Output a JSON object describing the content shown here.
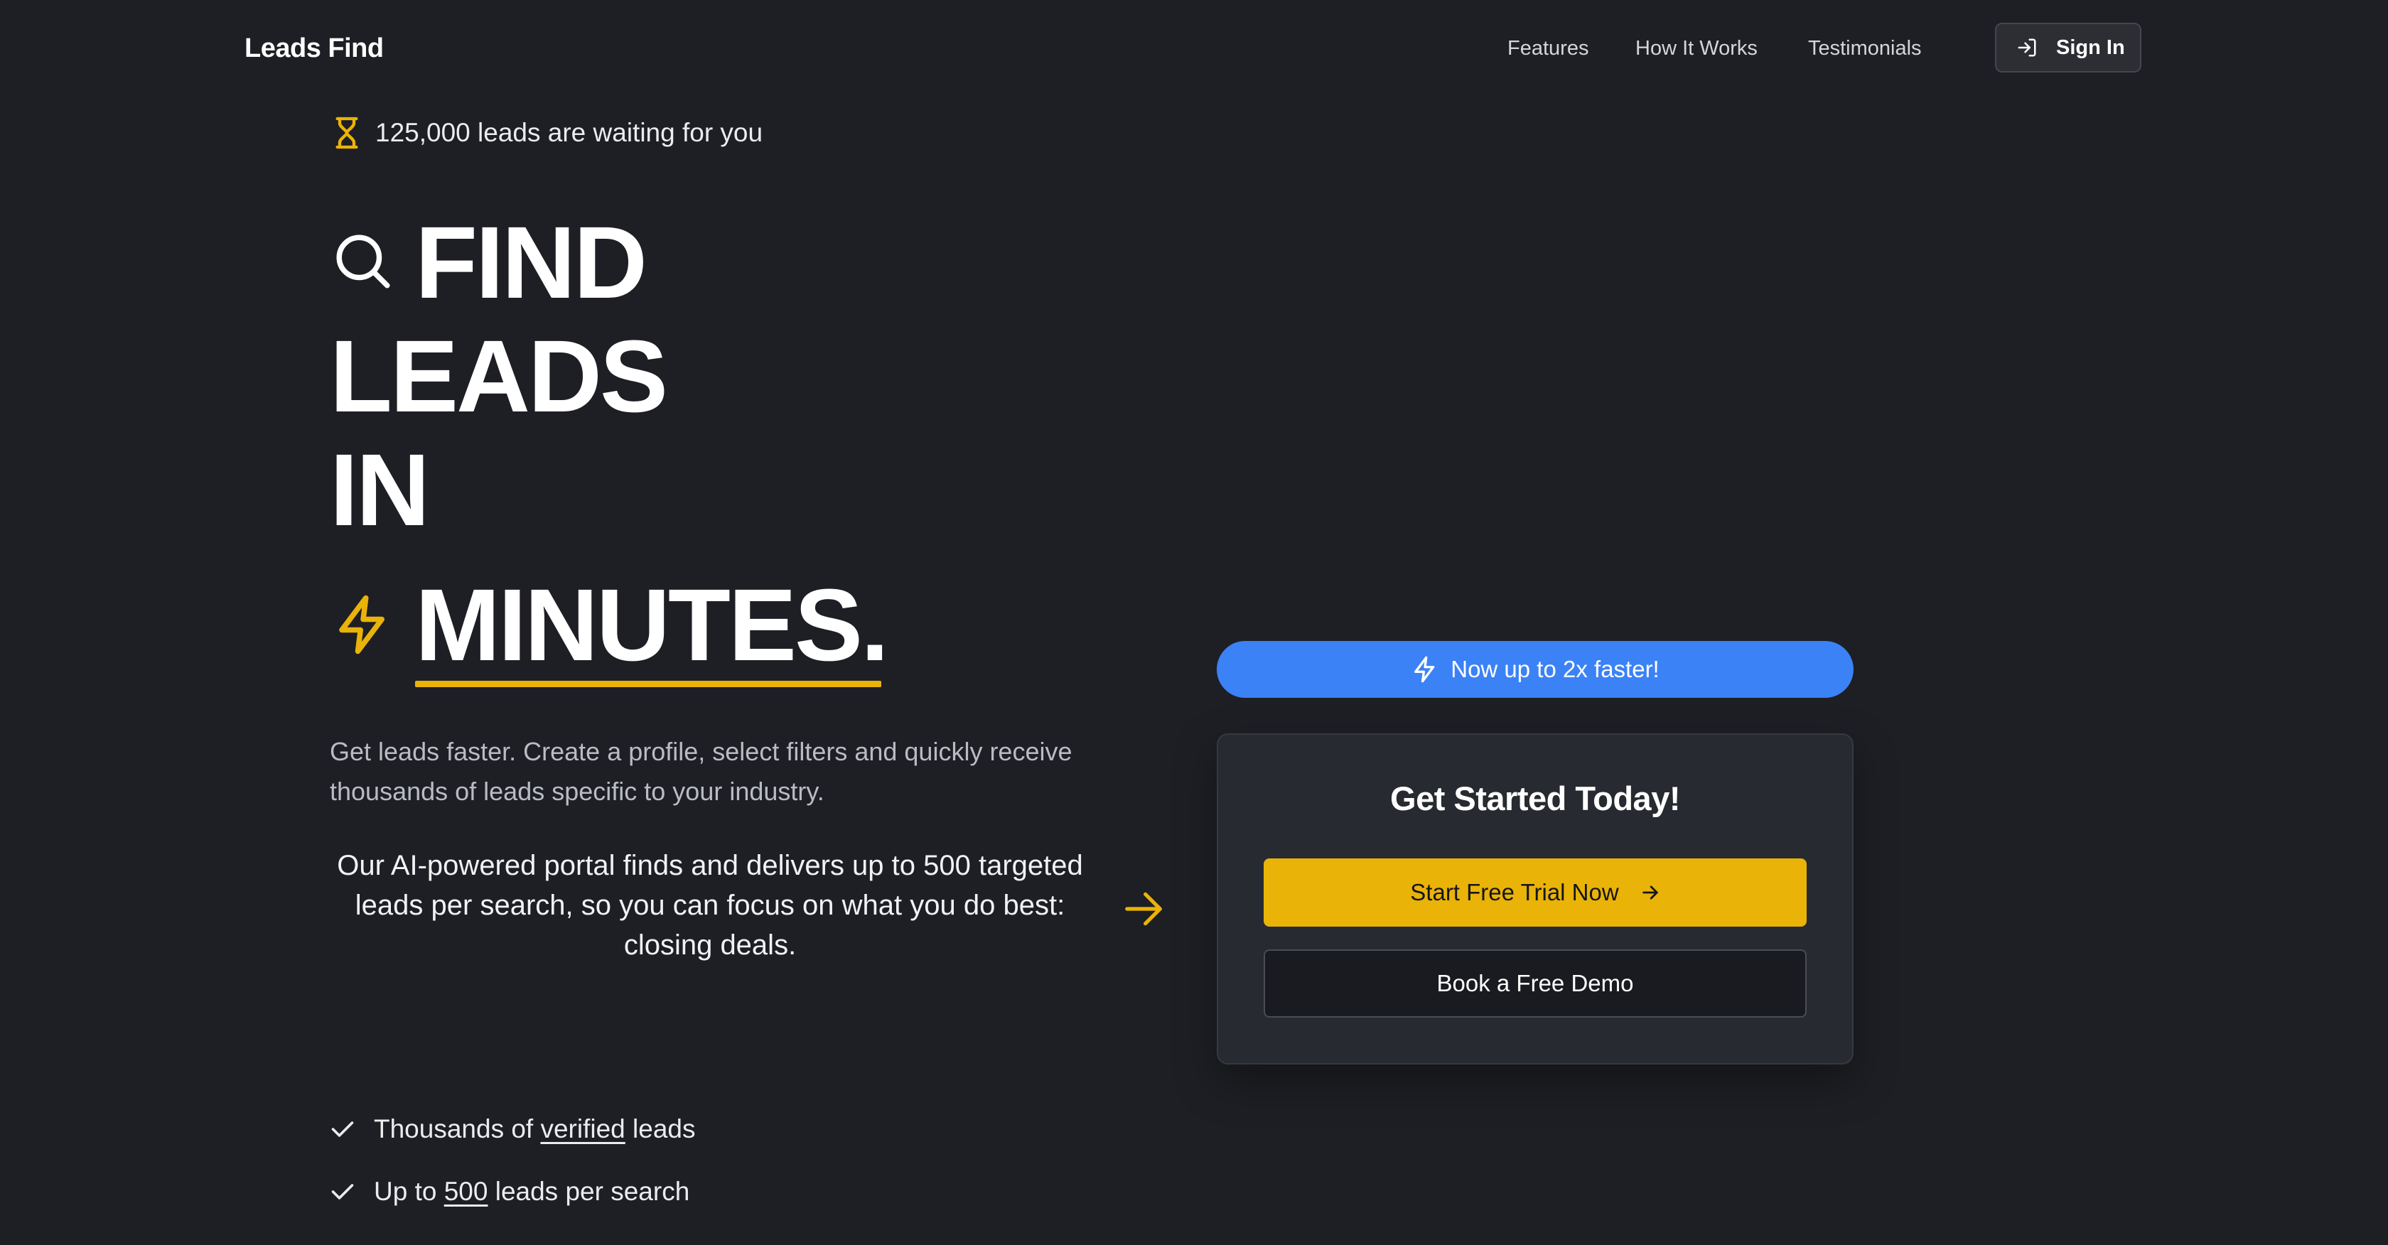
{
  "nav": {
    "brand": "Leads Find",
    "links": [
      "Features",
      "How It Works",
      "Testimonials"
    ],
    "signin_label": "Sign In"
  },
  "hero": {
    "badge_text": "125,000 leads are waiting for you",
    "headline": [
      "FIND",
      "LEADS",
      "IN",
      "MINUTES."
    ],
    "subtext": "Get leads faster. Create a profile, select filters and quickly receive thousands of leads specific to your industry.",
    "ai_text": "Our AI-powered portal finds and delivers up to 500 targeted leads per search, so you can focus on what you do best: closing deals."
  },
  "checklist": [
    {
      "before": "Thousands of ",
      "underlined": "verified",
      "after": " leads"
    },
    {
      "before": "Up to ",
      "underlined": "500",
      "after": " leads per search"
    }
  ],
  "cta": {
    "pill_text": "Now up to 2x faster!",
    "card_title": "Get Started Today!",
    "primary_label": "Start Free Trial Now",
    "secondary_label": "Book a Free Demo"
  },
  "icons": {
    "badge": "hourglass-icon",
    "headline_first": "search-icon",
    "headline_last": "lightning-icon",
    "ai_text": "arrow-right-icon",
    "checklist": "check-icon",
    "signin": "sign-in-icon",
    "pill": "lightning-icon",
    "primary_button": "arrow-right-icon"
  },
  "colors": {
    "background": "#1e1f24",
    "accent_yellow": "#eab308",
    "accent_blue": "#3b82f6",
    "card": "#282a31"
  }
}
